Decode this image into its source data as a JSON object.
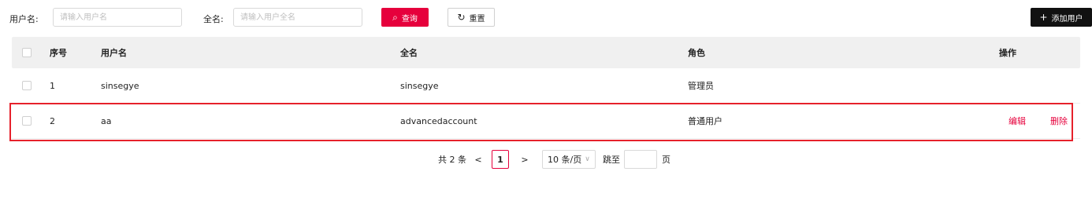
{
  "search": {
    "username_label": "用户名:",
    "username_placeholder": "请输入用户名",
    "username_value": "",
    "fullname_label": "全名:",
    "fullname_placeholder": "请输入用户全名",
    "fullname_value": "",
    "query_label": "查询",
    "reset_label": "重置",
    "add_user_label": "添加用户"
  },
  "table": {
    "columns": {
      "index": "序号",
      "username": "用户名",
      "fullname": "全名",
      "role": "角色",
      "actions": "操作"
    },
    "rows": [
      {
        "index": "1",
        "username": "sinsegye",
        "fullname": "sinsegye",
        "role": "管理员",
        "edit": "",
        "delete": ""
      },
      {
        "index": "2",
        "username": "aa",
        "fullname": "advancedaccount",
        "role": "普通用户",
        "edit": "编辑",
        "delete": "删除"
      }
    ]
  },
  "pagination": {
    "total_text": "共 2 条",
    "prev": "<",
    "current_page": "1",
    "next": ">",
    "page_size": "10 条/页",
    "jump_label": "跳至",
    "jump_value": "",
    "page_suffix": "页"
  },
  "colors": {
    "accent": "#e6003c",
    "highlight": "#e6212b",
    "header_bg": "#f0f0f0",
    "dark_button": "#111111"
  }
}
